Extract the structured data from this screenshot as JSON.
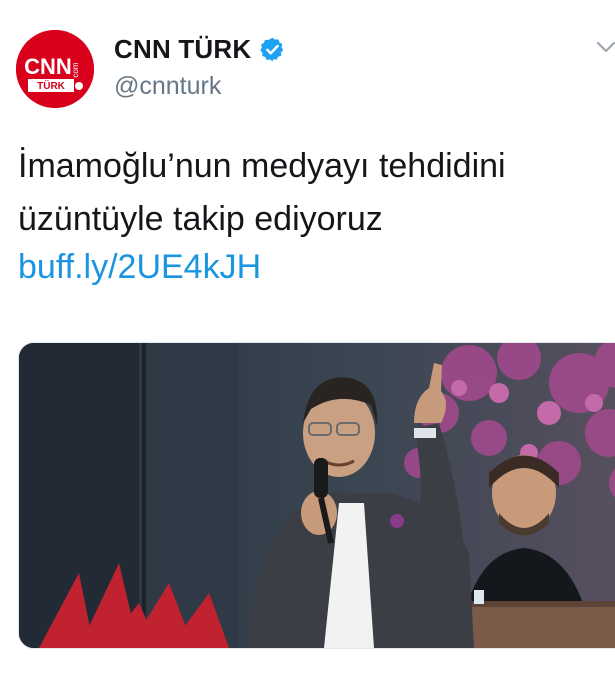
{
  "tweet": {
    "author": {
      "name": "CNN TÜRK",
      "handle": "@cnnturk",
      "verified": true,
      "avatar_logo_top": "CNN",
      "avatar_logo_side": "com",
      "avatar_logo_bottom": "TÜRK"
    },
    "text_lines": [
      "İmamoğlu’nun medyayı tehdidini",
      "üzüntüyle takip ediyoruz"
    ],
    "link": "buff.ly/2UE4kJH",
    "menu_icon": "chevron-down-icon",
    "media": {
      "type": "photo"
    }
  },
  "colors": {
    "brand_red": "#d9001b",
    "link_blue": "#1b95e0",
    "verified_blue": "#1da1f2",
    "handle_gray": "#657786",
    "text": "#14171a"
  }
}
